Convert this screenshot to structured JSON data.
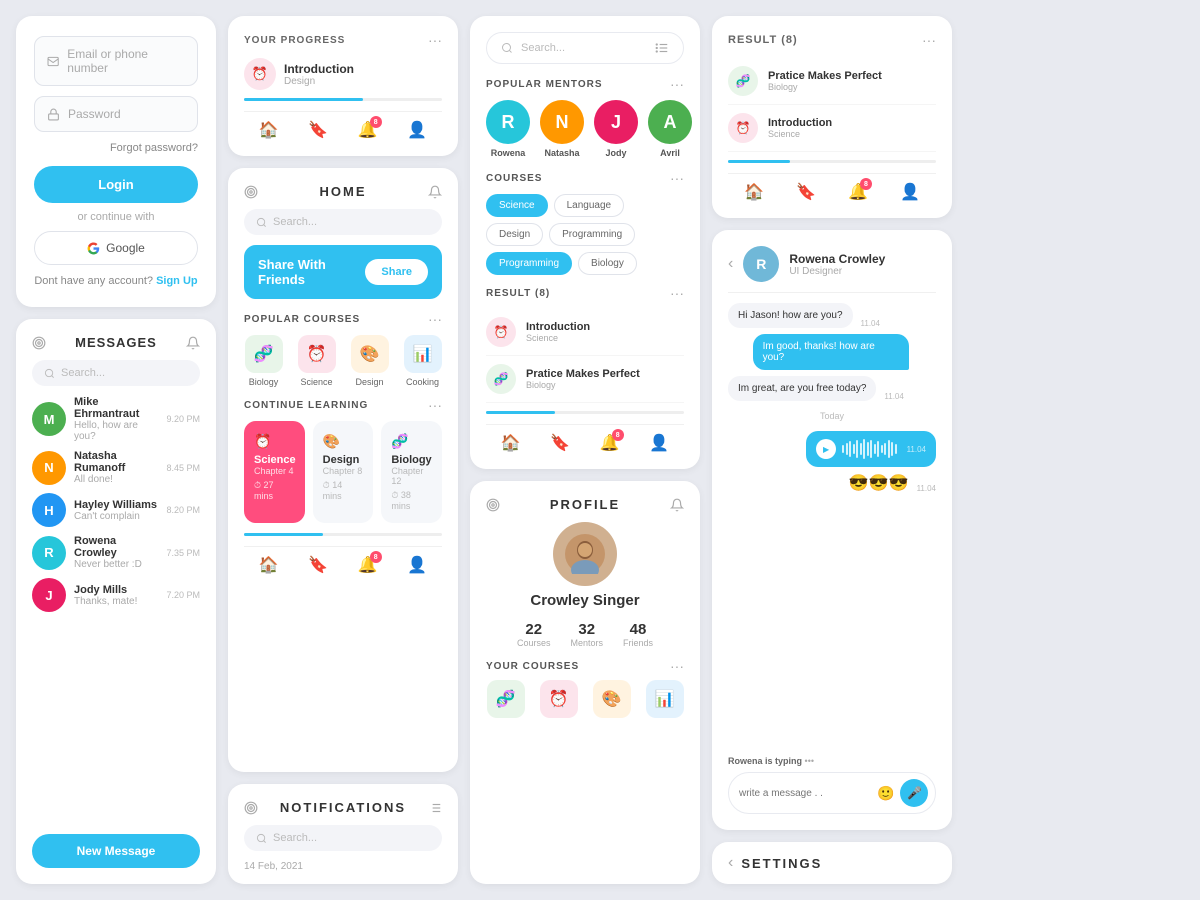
{
  "login": {
    "email_placeholder": "Email or phone number",
    "password_placeholder": "Password",
    "forgot_label": "Forgot password?",
    "login_button": "Login",
    "or_text": "or continue with",
    "google_button": "Google",
    "signup_prompt": "Dont have any account?",
    "signup_link": "Sign Up"
  },
  "messages": {
    "title": "MESSAGES",
    "search_placeholder": "Search...",
    "new_message_button": "New Message",
    "contacts": [
      {
        "name": "Mike Ehrmantraut",
        "preview": "Hello, how are you?",
        "time": "9.20 PM",
        "color": "#4caf50",
        "initials": "M"
      },
      {
        "name": "Natasha Rumanoff",
        "preview": "All done!",
        "time": "8.45 PM",
        "color": "#ff9800",
        "initials": "N"
      },
      {
        "name": "Hayley Williams",
        "preview": "Can't complain",
        "time": "8.20 PM",
        "color": "#2196f3",
        "initials": "H"
      },
      {
        "name": "Rowena Crowley",
        "preview": "Never better :D",
        "time": "7.35 PM",
        "color": "#26c6da",
        "initials": "R"
      },
      {
        "name": "Jody Mills",
        "preview": "Thanks, mate!",
        "time": "7.20 PM",
        "color": "#e91e63",
        "initials": "J"
      }
    ]
  },
  "progress": {
    "title": "YOUR PROGRESS",
    "item_name": "Introduction",
    "item_subject": "Design",
    "progress_percent": 60,
    "badge_count": "8"
  },
  "home": {
    "title": "HOME",
    "share_banner_text": "Share With Friends",
    "share_button": "Share",
    "popular_courses_title": "POPULAR COURSES",
    "courses": [
      {
        "label": "Biology",
        "icon": "🧬",
        "bg": "#e8f5e9"
      },
      {
        "label": "Science",
        "icon": "⏰",
        "bg": "#fce4ec"
      },
      {
        "label": "Design",
        "icon": "🎨",
        "bg": "#fff3e0"
      },
      {
        "label": "Cooking",
        "icon": "📊",
        "bg": "#e3f2fd"
      }
    ],
    "continue_title": "CONTINUE LEARNING",
    "continue_items": [
      {
        "subject": "Science",
        "chapter": "Chapter 4",
        "time": "27 mins",
        "active": true
      },
      {
        "subject": "Design",
        "chapter": "Chapter 8",
        "time": "14 mins",
        "active": false
      },
      {
        "subject": "Biology",
        "chapter": "Chapter 12",
        "time": "38 mins",
        "active": false
      }
    ],
    "badge_count": "8"
  },
  "notifications": {
    "title": "NOTIFICATIONS",
    "search_placeholder": "Search...",
    "date": "14 Feb, 2021"
  },
  "search_panel": {
    "search_placeholder": "Search...",
    "popular_mentors_title": "POPULAR MENTORS",
    "mentors": [
      {
        "name": "Rowena",
        "color": "#26c6da",
        "initials": "R"
      },
      {
        "name": "Natasha",
        "color": "#ff9800",
        "initials": "N"
      },
      {
        "name": "Jody",
        "color": "#e91e63",
        "initials": "J"
      },
      {
        "name": "Avril",
        "color": "#4caf50",
        "initials": "A"
      }
    ],
    "courses_title": "COURSES",
    "filter_tabs": [
      {
        "label": "Science",
        "active": true
      },
      {
        "label": "Language",
        "active": false
      },
      {
        "label": "Design",
        "active": false
      },
      {
        "label": "Programming",
        "active": false
      },
      {
        "label": "Programming",
        "active": true
      },
      {
        "label": "Biology",
        "active": false
      }
    ],
    "result_title": "RESULT (8)",
    "results": [
      {
        "name": "Introduction",
        "subject": "Science",
        "icon": "⏰",
        "bg": "#fce4ec"
      },
      {
        "name": "Pratice Makes Perfect",
        "subject": "Biology",
        "icon": "🧬",
        "bg": "#e8f5e9"
      }
    ],
    "badge_count": "8"
  },
  "profile": {
    "title": "PROFILE",
    "name": "Crowley Singer",
    "stats": [
      {
        "num": "22",
        "label": "Courses"
      },
      {
        "num": "32",
        "label": "Mentors"
      },
      {
        "num": "48",
        "label": "Friends"
      }
    ],
    "your_courses_title": "YOUR COURSES"
  },
  "result_right": {
    "title": "RESULT  (8)",
    "items": [
      {
        "name": "Pratice Makes Perfect",
        "subject": "Biology",
        "icon": "🧬",
        "bg": "#e8f5e9"
      },
      {
        "name": "Introduction",
        "subject": "Science",
        "icon": "⏰",
        "bg": "#fce4ec"
      }
    ],
    "badge_count": "8"
  },
  "chat": {
    "contact_name": "Rowena Crowley",
    "contact_role": "UI Designer",
    "messages": [
      {
        "text": "Hi Jason! how are you?",
        "time": "11.04",
        "type": "received"
      },
      {
        "text": "Im good, thanks! how are you?",
        "time": "11.04",
        "type": "sent"
      },
      {
        "text": "Im great, are you free today?",
        "time": "11.04",
        "type": "received"
      }
    ],
    "today_label": "Today",
    "voice_time": "11.04",
    "emoji_msg": "😎😎😎",
    "emoji_time": "11.04",
    "typing_name": "Rowena",
    "typing_text": "is typing",
    "input_placeholder": "write a message . ."
  },
  "settings": {
    "title": "SETTINGS"
  }
}
